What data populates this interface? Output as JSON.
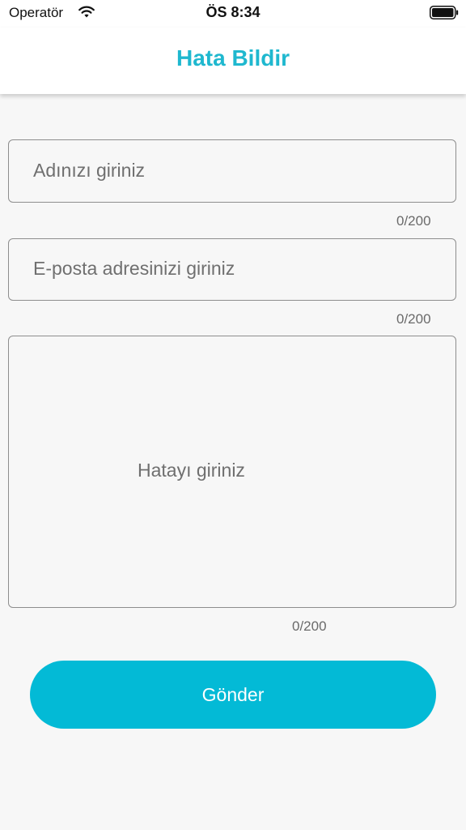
{
  "status_bar": {
    "carrier": "Operatör",
    "time": "ÖS 8:34",
    "icons": [
      "wifi-icon",
      "battery-icon"
    ]
  },
  "header": {
    "title": "Hata Bildir"
  },
  "form": {
    "name_field": {
      "value": "",
      "placeholder": "Adınızı giriniz",
      "counter": "0/200"
    },
    "email_field": {
      "value": "",
      "placeholder": "E-posta adresinizi giriniz",
      "counter": "0/200"
    },
    "message_field": {
      "value": "",
      "placeholder": "Hatayı giriniz",
      "counter": "0/200"
    },
    "submit_label": "Gönder"
  },
  "colors": {
    "accent": "#1fb8cf",
    "button": "#03bad6",
    "background": "#f7f7f7"
  }
}
